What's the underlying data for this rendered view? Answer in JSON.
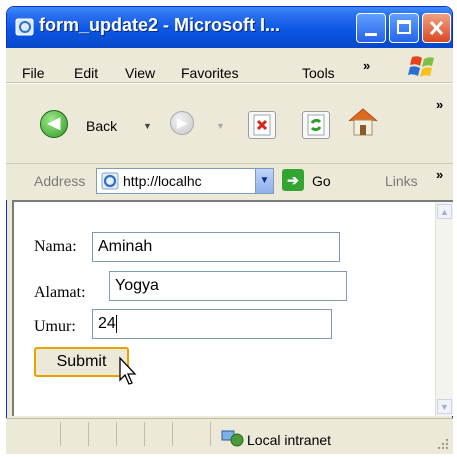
{
  "window": {
    "title": "form_update2 - Microsoft I..."
  },
  "menu": [
    "File",
    "Edit",
    "View",
    "Favorites",
    "Tools"
  ],
  "toolbar": {
    "back_label": "Back",
    "chevron": "»",
    "menu_chevron": "»",
    "links_chevron": "»"
  },
  "address": {
    "label": "Address",
    "url": "http://localhc",
    "go_label": "Go",
    "links_label": "Links"
  },
  "form": {
    "nama_label": "Nama:",
    "nama_value": "Aminah",
    "alamat_label": "Alamat:",
    "alamat_value": "Yogya",
    "umur_label": "Umur:",
    "umur_value": "24",
    "submit_label": "Submit"
  },
  "status": {
    "zone": "Local intranet"
  },
  "icons": {
    "back": "back-arrow-icon",
    "forward": "forward-arrow-icon",
    "stop": "stop-icon",
    "refresh": "refresh-icon",
    "home": "home-icon",
    "ie": "ie-page-icon",
    "go": "go-arrow-icon",
    "zone": "intranet-zone-icon",
    "cursor": "mouse-cursor-icon"
  },
  "colors": {
    "titlebar": "#0a56e4",
    "chrome": "#ece9d8",
    "submit_border": "#e6a300"
  }
}
